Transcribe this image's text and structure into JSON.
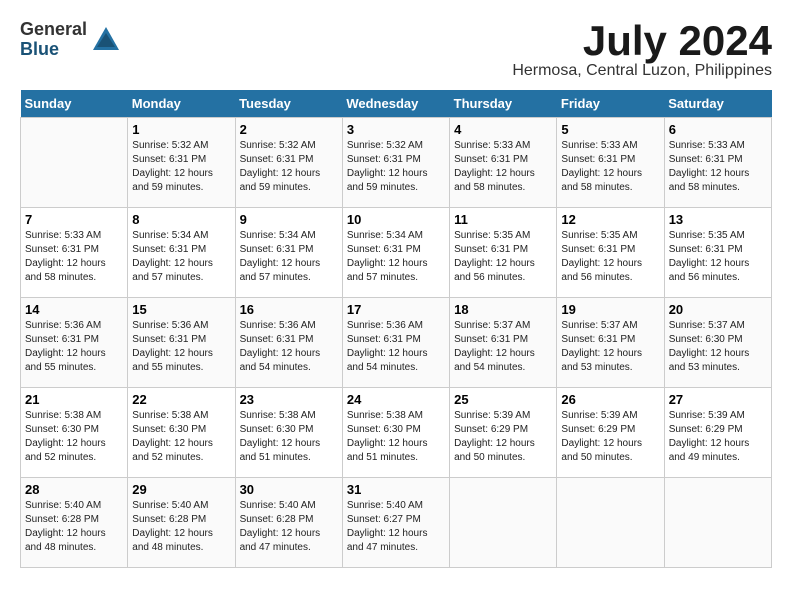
{
  "logo": {
    "general": "General",
    "blue": "Blue"
  },
  "title": {
    "month": "July 2024",
    "location": "Hermosa, Central Luzon, Philippines"
  },
  "headers": [
    "Sunday",
    "Monday",
    "Tuesday",
    "Wednesday",
    "Thursday",
    "Friday",
    "Saturday"
  ],
  "weeks": [
    [
      {
        "day": "",
        "sunrise": "",
        "sunset": "",
        "daylight": ""
      },
      {
        "day": "1",
        "sunrise": "Sunrise: 5:32 AM",
        "sunset": "Sunset: 6:31 PM",
        "daylight": "Daylight: 12 hours and 59 minutes."
      },
      {
        "day": "2",
        "sunrise": "Sunrise: 5:32 AM",
        "sunset": "Sunset: 6:31 PM",
        "daylight": "Daylight: 12 hours and 59 minutes."
      },
      {
        "day": "3",
        "sunrise": "Sunrise: 5:32 AM",
        "sunset": "Sunset: 6:31 PM",
        "daylight": "Daylight: 12 hours and 59 minutes."
      },
      {
        "day": "4",
        "sunrise": "Sunrise: 5:33 AM",
        "sunset": "Sunset: 6:31 PM",
        "daylight": "Daylight: 12 hours and 58 minutes."
      },
      {
        "day": "5",
        "sunrise": "Sunrise: 5:33 AM",
        "sunset": "Sunset: 6:31 PM",
        "daylight": "Daylight: 12 hours and 58 minutes."
      },
      {
        "day": "6",
        "sunrise": "Sunrise: 5:33 AM",
        "sunset": "Sunset: 6:31 PM",
        "daylight": "Daylight: 12 hours and 58 minutes."
      }
    ],
    [
      {
        "day": "7",
        "sunrise": "Sunrise: 5:33 AM",
        "sunset": "Sunset: 6:31 PM",
        "daylight": "Daylight: 12 hours and 58 minutes."
      },
      {
        "day": "8",
        "sunrise": "Sunrise: 5:34 AM",
        "sunset": "Sunset: 6:31 PM",
        "daylight": "Daylight: 12 hours and 57 minutes."
      },
      {
        "day": "9",
        "sunrise": "Sunrise: 5:34 AM",
        "sunset": "Sunset: 6:31 PM",
        "daylight": "Daylight: 12 hours and 57 minutes."
      },
      {
        "day": "10",
        "sunrise": "Sunrise: 5:34 AM",
        "sunset": "Sunset: 6:31 PM",
        "daylight": "Daylight: 12 hours and 57 minutes."
      },
      {
        "day": "11",
        "sunrise": "Sunrise: 5:35 AM",
        "sunset": "Sunset: 6:31 PM",
        "daylight": "Daylight: 12 hours and 56 minutes."
      },
      {
        "day": "12",
        "sunrise": "Sunrise: 5:35 AM",
        "sunset": "Sunset: 6:31 PM",
        "daylight": "Daylight: 12 hours and 56 minutes."
      },
      {
        "day": "13",
        "sunrise": "Sunrise: 5:35 AM",
        "sunset": "Sunset: 6:31 PM",
        "daylight": "Daylight: 12 hours and 56 minutes."
      }
    ],
    [
      {
        "day": "14",
        "sunrise": "Sunrise: 5:36 AM",
        "sunset": "Sunset: 6:31 PM",
        "daylight": "Daylight: 12 hours and 55 minutes."
      },
      {
        "day": "15",
        "sunrise": "Sunrise: 5:36 AM",
        "sunset": "Sunset: 6:31 PM",
        "daylight": "Daylight: 12 hours and 55 minutes."
      },
      {
        "day": "16",
        "sunrise": "Sunrise: 5:36 AM",
        "sunset": "Sunset: 6:31 PM",
        "daylight": "Daylight: 12 hours and 54 minutes."
      },
      {
        "day": "17",
        "sunrise": "Sunrise: 5:36 AM",
        "sunset": "Sunset: 6:31 PM",
        "daylight": "Daylight: 12 hours and 54 minutes."
      },
      {
        "day": "18",
        "sunrise": "Sunrise: 5:37 AM",
        "sunset": "Sunset: 6:31 PM",
        "daylight": "Daylight: 12 hours and 54 minutes."
      },
      {
        "day": "19",
        "sunrise": "Sunrise: 5:37 AM",
        "sunset": "Sunset: 6:31 PM",
        "daylight": "Daylight: 12 hours and 53 minutes."
      },
      {
        "day": "20",
        "sunrise": "Sunrise: 5:37 AM",
        "sunset": "Sunset: 6:30 PM",
        "daylight": "Daylight: 12 hours and 53 minutes."
      }
    ],
    [
      {
        "day": "21",
        "sunrise": "Sunrise: 5:38 AM",
        "sunset": "Sunset: 6:30 PM",
        "daylight": "Daylight: 12 hours and 52 minutes."
      },
      {
        "day": "22",
        "sunrise": "Sunrise: 5:38 AM",
        "sunset": "Sunset: 6:30 PM",
        "daylight": "Daylight: 12 hours and 52 minutes."
      },
      {
        "day": "23",
        "sunrise": "Sunrise: 5:38 AM",
        "sunset": "Sunset: 6:30 PM",
        "daylight": "Daylight: 12 hours and 51 minutes."
      },
      {
        "day": "24",
        "sunrise": "Sunrise: 5:38 AM",
        "sunset": "Sunset: 6:30 PM",
        "daylight": "Daylight: 12 hours and 51 minutes."
      },
      {
        "day": "25",
        "sunrise": "Sunrise: 5:39 AM",
        "sunset": "Sunset: 6:29 PM",
        "daylight": "Daylight: 12 hours and 50 minutes."
      },
      {
        "day": "26",
        "sunrise": "Sunrise: 5:39 AM",
        "sunset": "Sunset: 6:29 PM",
        "daylight": "Daylight: 12 hours and 50 minutes."
      },
      {
        "day": "27",
        "sunrise": "Sunrise: 5:39 AM",
        "sunset": "Sunset: 6:29 PM",
        "daylight": "Daylight: 12 hours and 49 minutes."
      }
    ],
    [
      {
        "day": "28",
        "sunrise": "Sunrise: 5:40 AM",
        "sunset": "Sunset: 6:28 PM",
        "daylight": "Daylight: 12 hours and 48 minutes."
      },
      {
        "day": "29",
        "sunrise": "Sunrise: 5:40 AM",
        "sunset": "Sunset: 6:28 PM",
        "daylight": "Daylight: 12 hours and 48 minutes."
      },
      {
        "day": "30",
        "sunrise": "Sunrise: 5:40 AM",
        "sunset": "Sunset: 6:28 PM",
        "daylight": "Daylight: 12 hours and 47 minutes."
      },
      {
        "day": "31",
        "sunrise": "Sunrise: 5:40 AM",
        "sunset": "Sunset: 6:27 PM",
        "daylight": "Daylight: 12 hours and 47 minutes."
      },
      {
        "day": "",
        "sunrise": "",
        "sunset": "",
        "daylight": ""
      },
      {
        "day": "",
        "sunrise": "",
        "sunset": "",
        "daylight": ""
      },
      {
        "day": "",
        "sunrise": "",
        "sunset": "",
        "daylight": ""
      }
    ]
  ]
}
